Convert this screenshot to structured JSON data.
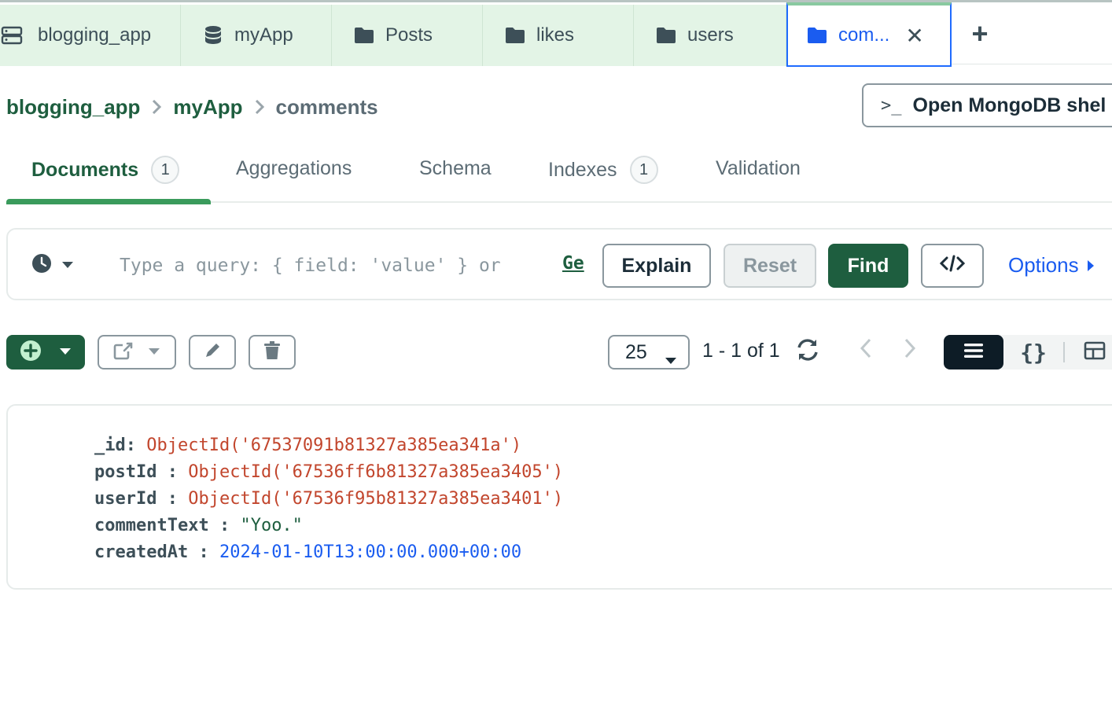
{
  "tabs": [
    {
      "label": "blogging_app",
      "icon": "server-icon"
    },
    {
      "label": "myApp",
      "icon": "database-icon"
    },
    {
      "label": "Posts",
      "icon": "folder-icon"
    },
    {
      "label": "likes",
      "icon": "folder-icon"
    },
    {
      "label": "users",
      "icon": "folder-icon"
    },
    {
      "label": "com...",
      "icon": "folder-icon",
      "active": true
    }
  ],
  "breadcrumb": {
    "items": [
      "blogging_app",
      "myApp",
      "comments"
    ]
  },
  "shell_button": {
    "label": "Open MongoDB shel"
  },
  "collection_tabs": [
    {
      "label": "Documents",
      "count": "1",
      "active": true
    },
    {
      "label": "Aggregations"
    },
    {
      "label": "Schema"
    },
    {
      "label": "Indexes",
      "count": "1"
    },
    {
      "label": "Validation"
    }
  ],
  "query": {
    "placeholder": "Type a query: { field: 'value' } or",
    "generate_link": "Ge",
    "explain_label": "Explain",
    "reset_label": "Reset",
    "find_label": "Find",
    "options_label": "Options"
  },
  "pagination": {
    "page_size": "25",
    "range_text": "1 - 1 of 1"
  },
  "document": {
    "fields": [
      {
        "key": "_id",
        "sep": ": ",
        "value": "ObjectId('67537091b81327a385ea341a')",
        "type": "oid"
      },
      {
        "key": "postId",
        "sep": " : ",
        "value": "ObjectId('67536ff6b81327a385ea3405')",
        "type": "oid"
      },
      {
        "key": "userId",
        "sep": " : ",
        "value": "ObjectId('67536f95b81327a385ea3401')",
        "type": "oid"
      },
      {
        "key": "commentText",
        "sep": " : ",
        "value": "\"Yoo.\"",
        "type": "str"
      },
      {
        "key": "createdAt",
        "sep": " : ",
        "value": "2024-01-10T13:00:00.000+00:00",
        "type": "date"
      }
    ]
  },
  "colors": {
    "brand_green": "#1e5e3f",
    "tab_bg": "#e3f4e6",
    "active_blue": "#1a5cf0",
    "oid_red": "#c2462d"
  }
}
